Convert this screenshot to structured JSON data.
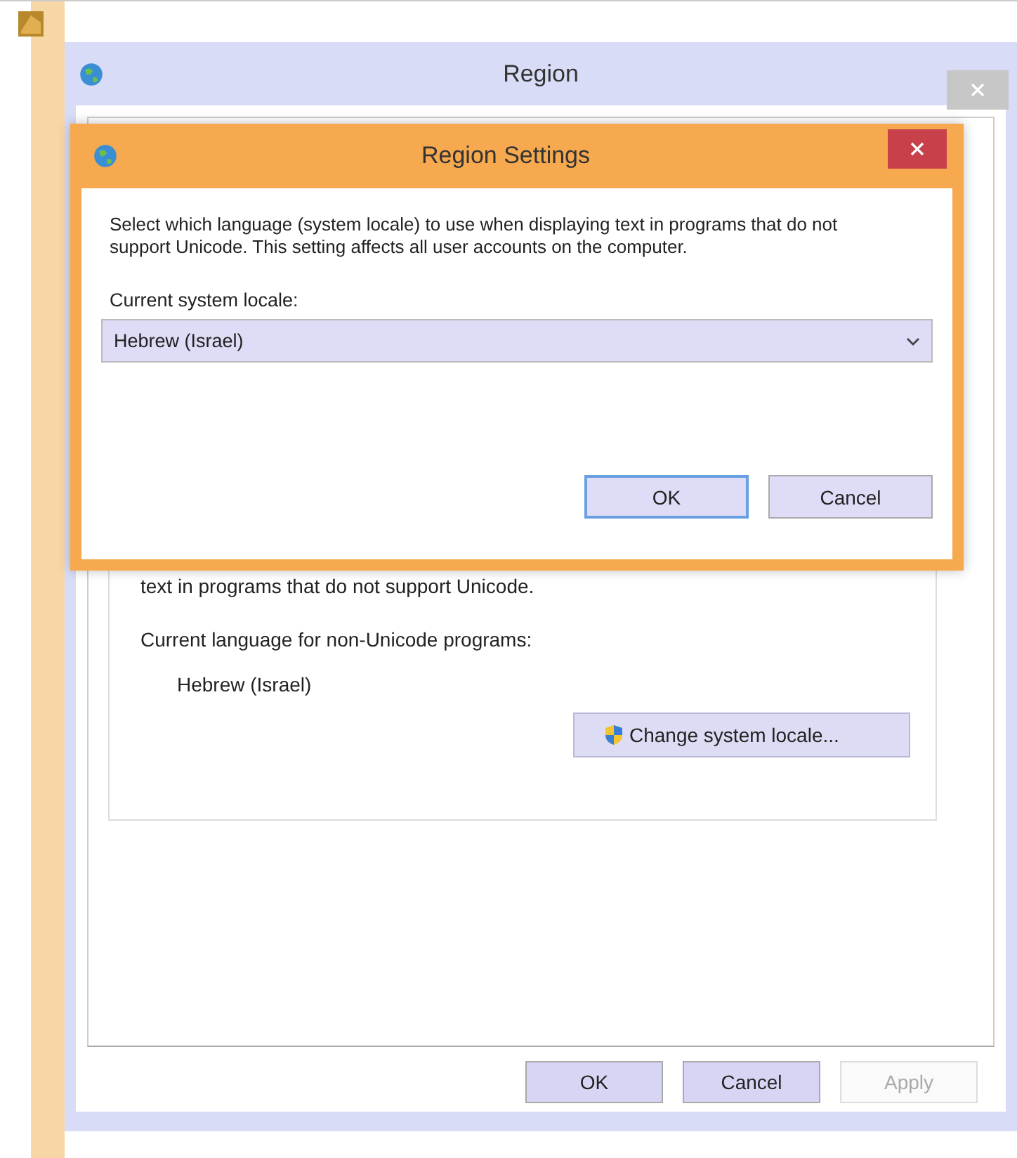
{
  "window": {
    "title": "Region"
  },
  "group": {
    "text": "text in programs that do not support Unicode.",
    "current_label": "Current language for non-Unicode programs:",
    "current_value": "Hebrew (Israel)",
    "change_button": "Change system locale..."
  },
  "buttons": [
    {
      "label": "OK",
      "disabled": false
    },
    {
      "label": "Cancel",
      "disabled": false
    },
    {
      "label": "Apply",
      "disabled": true
    }
  ],
  "dialog": {
    "title": "Region Settings",
    "description": "Select which language (system locale) to use when displaying text in programs that do not support Unicode. This setting affects all user accounts on the computer.",
    "locale_label": "Current system locale:",
    "locale_value": "Hebrew (Israel)",
    "buttons": [
      {
        "label": "OK",
        "default": true
      },
      {
        "label": "Cancel",
        "default": false
      }
    ]
  }
}
